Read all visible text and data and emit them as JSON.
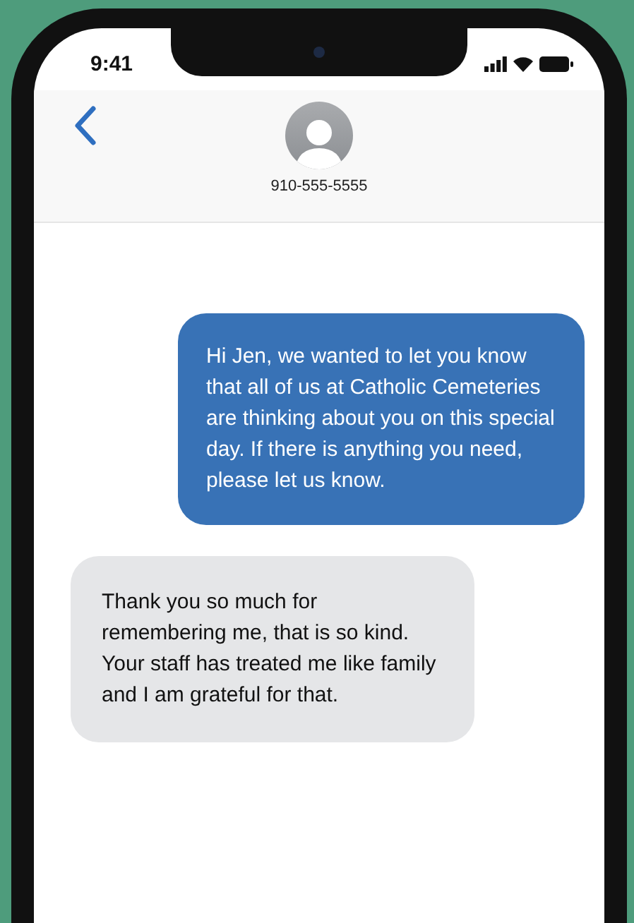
{
  "status_bar": {
    "time": "9:41"
  },
  "contact": {
    "number": "910-555-5555"
  },
  "messages": [
    {
      "kind": "sent",
      "text": "Hi Jen, we wanted to let you know that all of us at Catholic Cemeteries are thinking about you on this special day. If there is anything you need, please let us know."
    },
    {
      "kind": "received",
      "text": "Thank you so much for remembering me, that is so kind. Your staff has treated me like family and I am grateful for that."
    }
  ]
}
